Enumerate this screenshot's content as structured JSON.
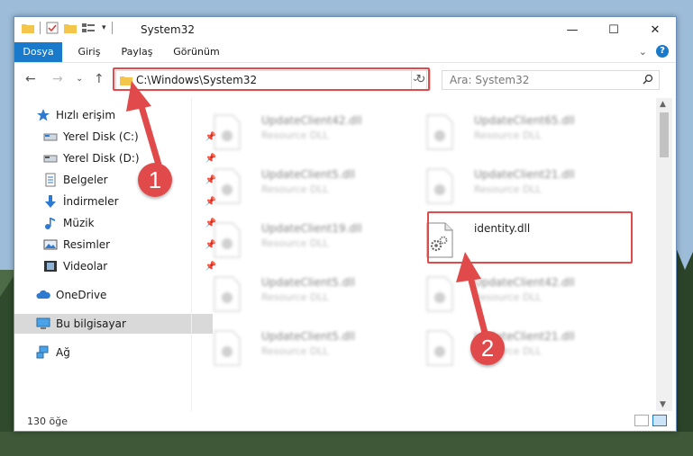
{
  "window": {
    "title": "System32",
    "controls": {
      "minimize": "—",
      "maximize": "☐",
      "close": "✕"
    }
  },
  "ribbon": {
    "tabs": [
      "Dosya",
      "Giriş",
      "Paylaş",
      "Görünüm"
    ],
    "help": "?",
    "expand": "⌄"
  },
  "address": {
    "path": "C:\\Windows\\System32",
    "refresh": "↻",
    "dropdown": "⌄"
  },
  "search": {
    "placeholder": "Ara: System32"
  },
  "nav": {
    "back": "←",
    "forward": "→",
    "recent": "⌄",
    "up": "↑"
  },
  "sidebar": {
    "items": [
      {
        "label": "Hızlı erişim",
        "icon": "star-icon"
      },
      {
        "label": "Yerel Disk (C:)",
        "icon": "drive-icon",
        "pinned": true
      },
      {
        "label": "Yerel Disk (D:)",
        "icon": "drive-icon",
        "pinned": true
      },
      {
        "label": "Belgeler",
        "icon": "documents-icon",
        "pinned": true
      },
      {
        "label": "İndirmeler",
        "icon": "download-icon",
        "pinned": true
      },
      {
        "label": "Müzik",
        "icon": "music-icon",
        "pinned": true
      },
      {
        "label": "Resimler",
        "icon": "pictures-icon",
        "pinned": true
      },
      {
        "label": "Videolar",
        "icon": "videos-icon",
        "pinned": true
      },
      {
        "label": "OneDrive",
        "icon": "cloud-icon"
      },
      {
        "label": "Bu bilgisayar",
        "icon": "computer-icon",
        "selected": true
      },
      {
        "label": "Ağ",
        "icon": "network-icon"
      }
    ]
  },
  "files": [
    {
      "name": "UpdateClient42.dll",
      "type": "Resource DLL"
    },
    {
      "name": "UpdateClient65.dll",
      "type": "Resource DLL"
    },
    {
      "name": "UpdateClient5.dll",
      "type": "Resource DLL"
    },
    {
      "name": "UpdateClient21.dll",
      "type": "Resource DLL"
    },
    {
      "name": "UpdateClient19.dll",
      "type": "Resource DLL"
    },
    {
      "name": "identity.dll",
      "type": ""
    },
    {
      "name": "UpdateClient5.dll",
      "type": "Resource DLL"
    },
    {
      "name": "UpdateClient42.dll",
      "type": "Resource DLL"
    },
    {
      "name": "UpdateClient5.dll",
      "type": "Resource DLL"
    },
    {
      "name": "UpdateClient21.dll",
      "type": "Resource DLL"
    }
  ],
  "status": {
    "count": "130 öğe"
  },
  "annotations": {
    "step1": "1",
    "step2": "2",
    "accent": "#e04a4a"
  },
  "colors": {
    "accent": "#1979ca",
    "highlight": "#e04a4a",
    "selected": "#d9d9d9"
  }
}
